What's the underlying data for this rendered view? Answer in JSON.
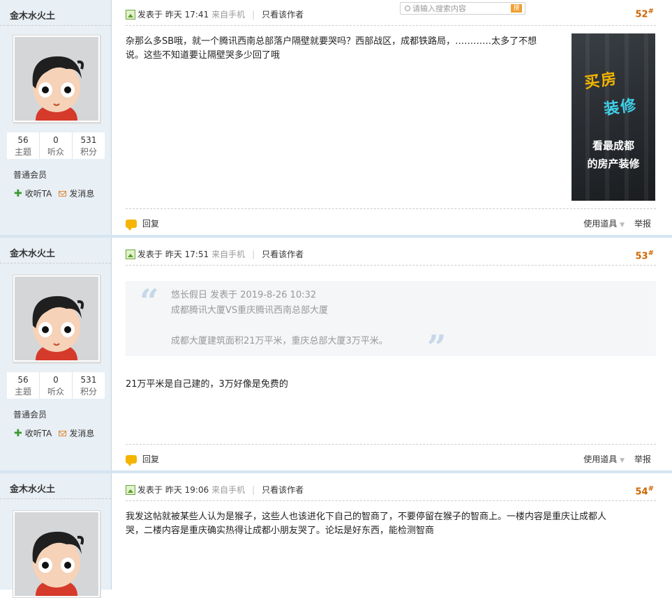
{
  "search": {
    "placeholder": "请输入搜索内容",
    "button": "搜"
  },
  "posts": [
    {
      "user": {
        "name": "金木水火土",
        "stats": [
          {
            "num": "56",
            "label": "主题"
          },
          {
            "num": "0",
            "label": "听众"
          },
          {
            "num": "531",
            "label": "积分"
          }
        ],
        "rank": "普通会员",
        "follow": "收听TA",
        "message": "发消息"
      },
      "meta": {
        "prefix": "发表于",
        "time": "昨天 17:41",
        "source": "来自手机",
        "only_author": "只看该作者"
      },
      "floor": "52",
      "text_lines": [
        "杂那么多SB哦，就一个腾讯西南总部落户隔壁就要哭吗？西部战区，成都铁路局，…………太多了不想",
        "说。这些不知道要让隔壁哭多少回了哦"
      ],
      "ad": {
        "line1": "买房",
        "line2": "装修",
        "line3": "看最成都",
        "line4": "的房产装修"
      },
      "reply": "回复",
      "tools": "使用道具",
      "report": "举报"
    },
    {
      "user": {
        "name": "金木水火土",
        "stats": [
          {
            "num": "56",
            "label": "主题"
          },
          {
            "num": "0",
            "label": "听众"
          },
          {
            "num": "531",
            "label": "积分"
          }
        ],
        "rank": "普通会员",
        "follow": "收听TA",
        "message": "发消息"
      },
      "meta": {
        "prefix": "发表于",
        "time": "昨天 17:51",
        "source": "来自手机",
        "only_author": "只看该作者"
      },
      "floor": "53",
      "quote": {
        "header": "悠长假日 发表于 2019-8-26 10:32",
        "line1": "成都腾讯大厦VS重庆腾讯西南总部大厦",
        "line2": "成都大厦建筑面积21万平米，重庆总部大厦3万平米。"
      },
      "text_lines": [
        "21万平米是自己建的，3万好像是免费的"
      ],
      "reply": "回复",
      "tools": "使用道具",
      "report": "举报"
    },
    {
      "user": {
        "name": "金木水火土"
      },
      "meta": {
        "prefix": "发表于",
        "time": "昨天 19:06",
        "source": "来自手机",
        "only_author": "只看该作者"
      },
      "floor": "54",
      "text_lines": [
        "我发这帖就被某些人认为是猴子，这些人也该进化下自己的智商了，不要停留在猴子的智商上。一楼内容是重庆让成都人",
        "哭，二楼内容是重庆确实热得让成都小朋友哭了。论坛是好东西，能检测智商"
      ]
    }
  ],
  "colors": {
    "sidebar": "#e8eff5",
    "floor": "#cc6600",
    "separator": "#d5e4f1"
  }
}
